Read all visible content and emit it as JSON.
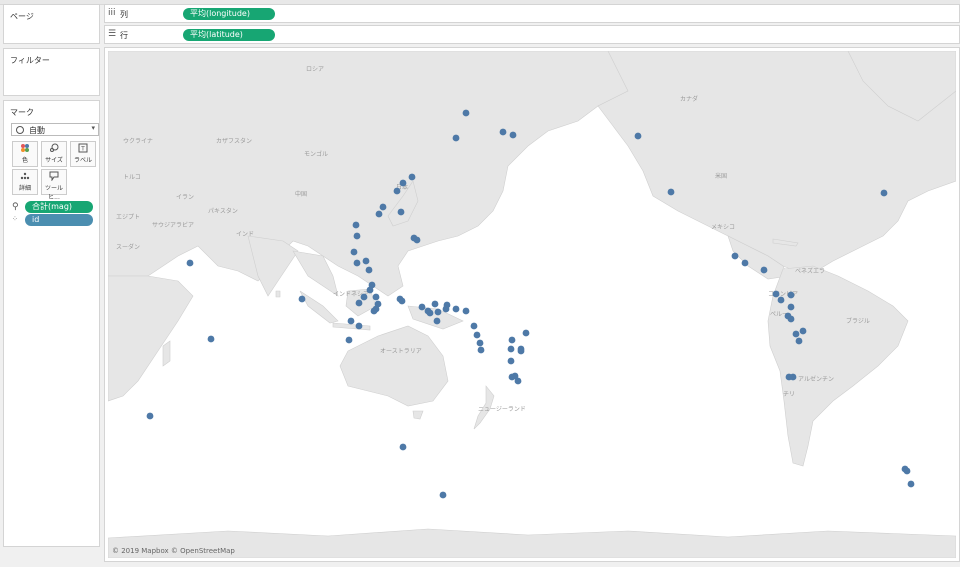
{
  "pages_panel": {
    "title": "ページ"
  },
  "filters_panel": {
    "title": "フィルター"
  },
  "marks_panel": {
    "title": "マーク",
    "mark_type": "自動",
    "buttons": [
      {
        "label": "色",
        "icon": "color-icon"
      },
      {
        "label": "サイズ",
        "icon": "size-icon"
      },
      {
        "label": "ラベル",
        "icon": "label-icon"
      },
      {
        "label": "詳細",
        "icon": "detail-icon"
      },
      {
        "label": "ツールヒ...",
        "icon": "tooltip-icon"
      }
    ],
    "fields": [
      {
        "text": "合計(mag)",
        "icon": "size-icon",
        "color": "#17a673"
      },
      {
        "text": "id",
        "icon": "detail-icon",
        "color": "#4b8eb0"
      }
    ]
  },
  "shelves": {
    "columns": {
      "label": "列",
      "pill": "平均(longitude)"
    },
    "rows": {
      "label": "行",
      "pill": "平均(latitude)"
    }
  },
  "map": {
    "labels": [
      "ロシア",
      "カナダ",
      "米国",
      "メキシコ",
      "ブラジル",
      "ベネズエラ",
      "コロンビア",
      "ペルー",
      "アルゼンチン",
      "チリ",
      "中国",
      "日本",
      "モンゴル",
      "カザフスタン",
      "イラン",
      "サウジアラビア",
      "インド",
      "パキスタン",
      "インドネシア",
      "オーストラリア",
      "ニュージーランド",
      "ウクライナ",
      "トルコ",
      "エジプト",
      "スーダン"
    ],
    "credit": "© 2019 Mapbox © OpenStreetMap",
    "land_color": "#e6e6e6",
    "point_color": "#4e79a7"
  }
}
